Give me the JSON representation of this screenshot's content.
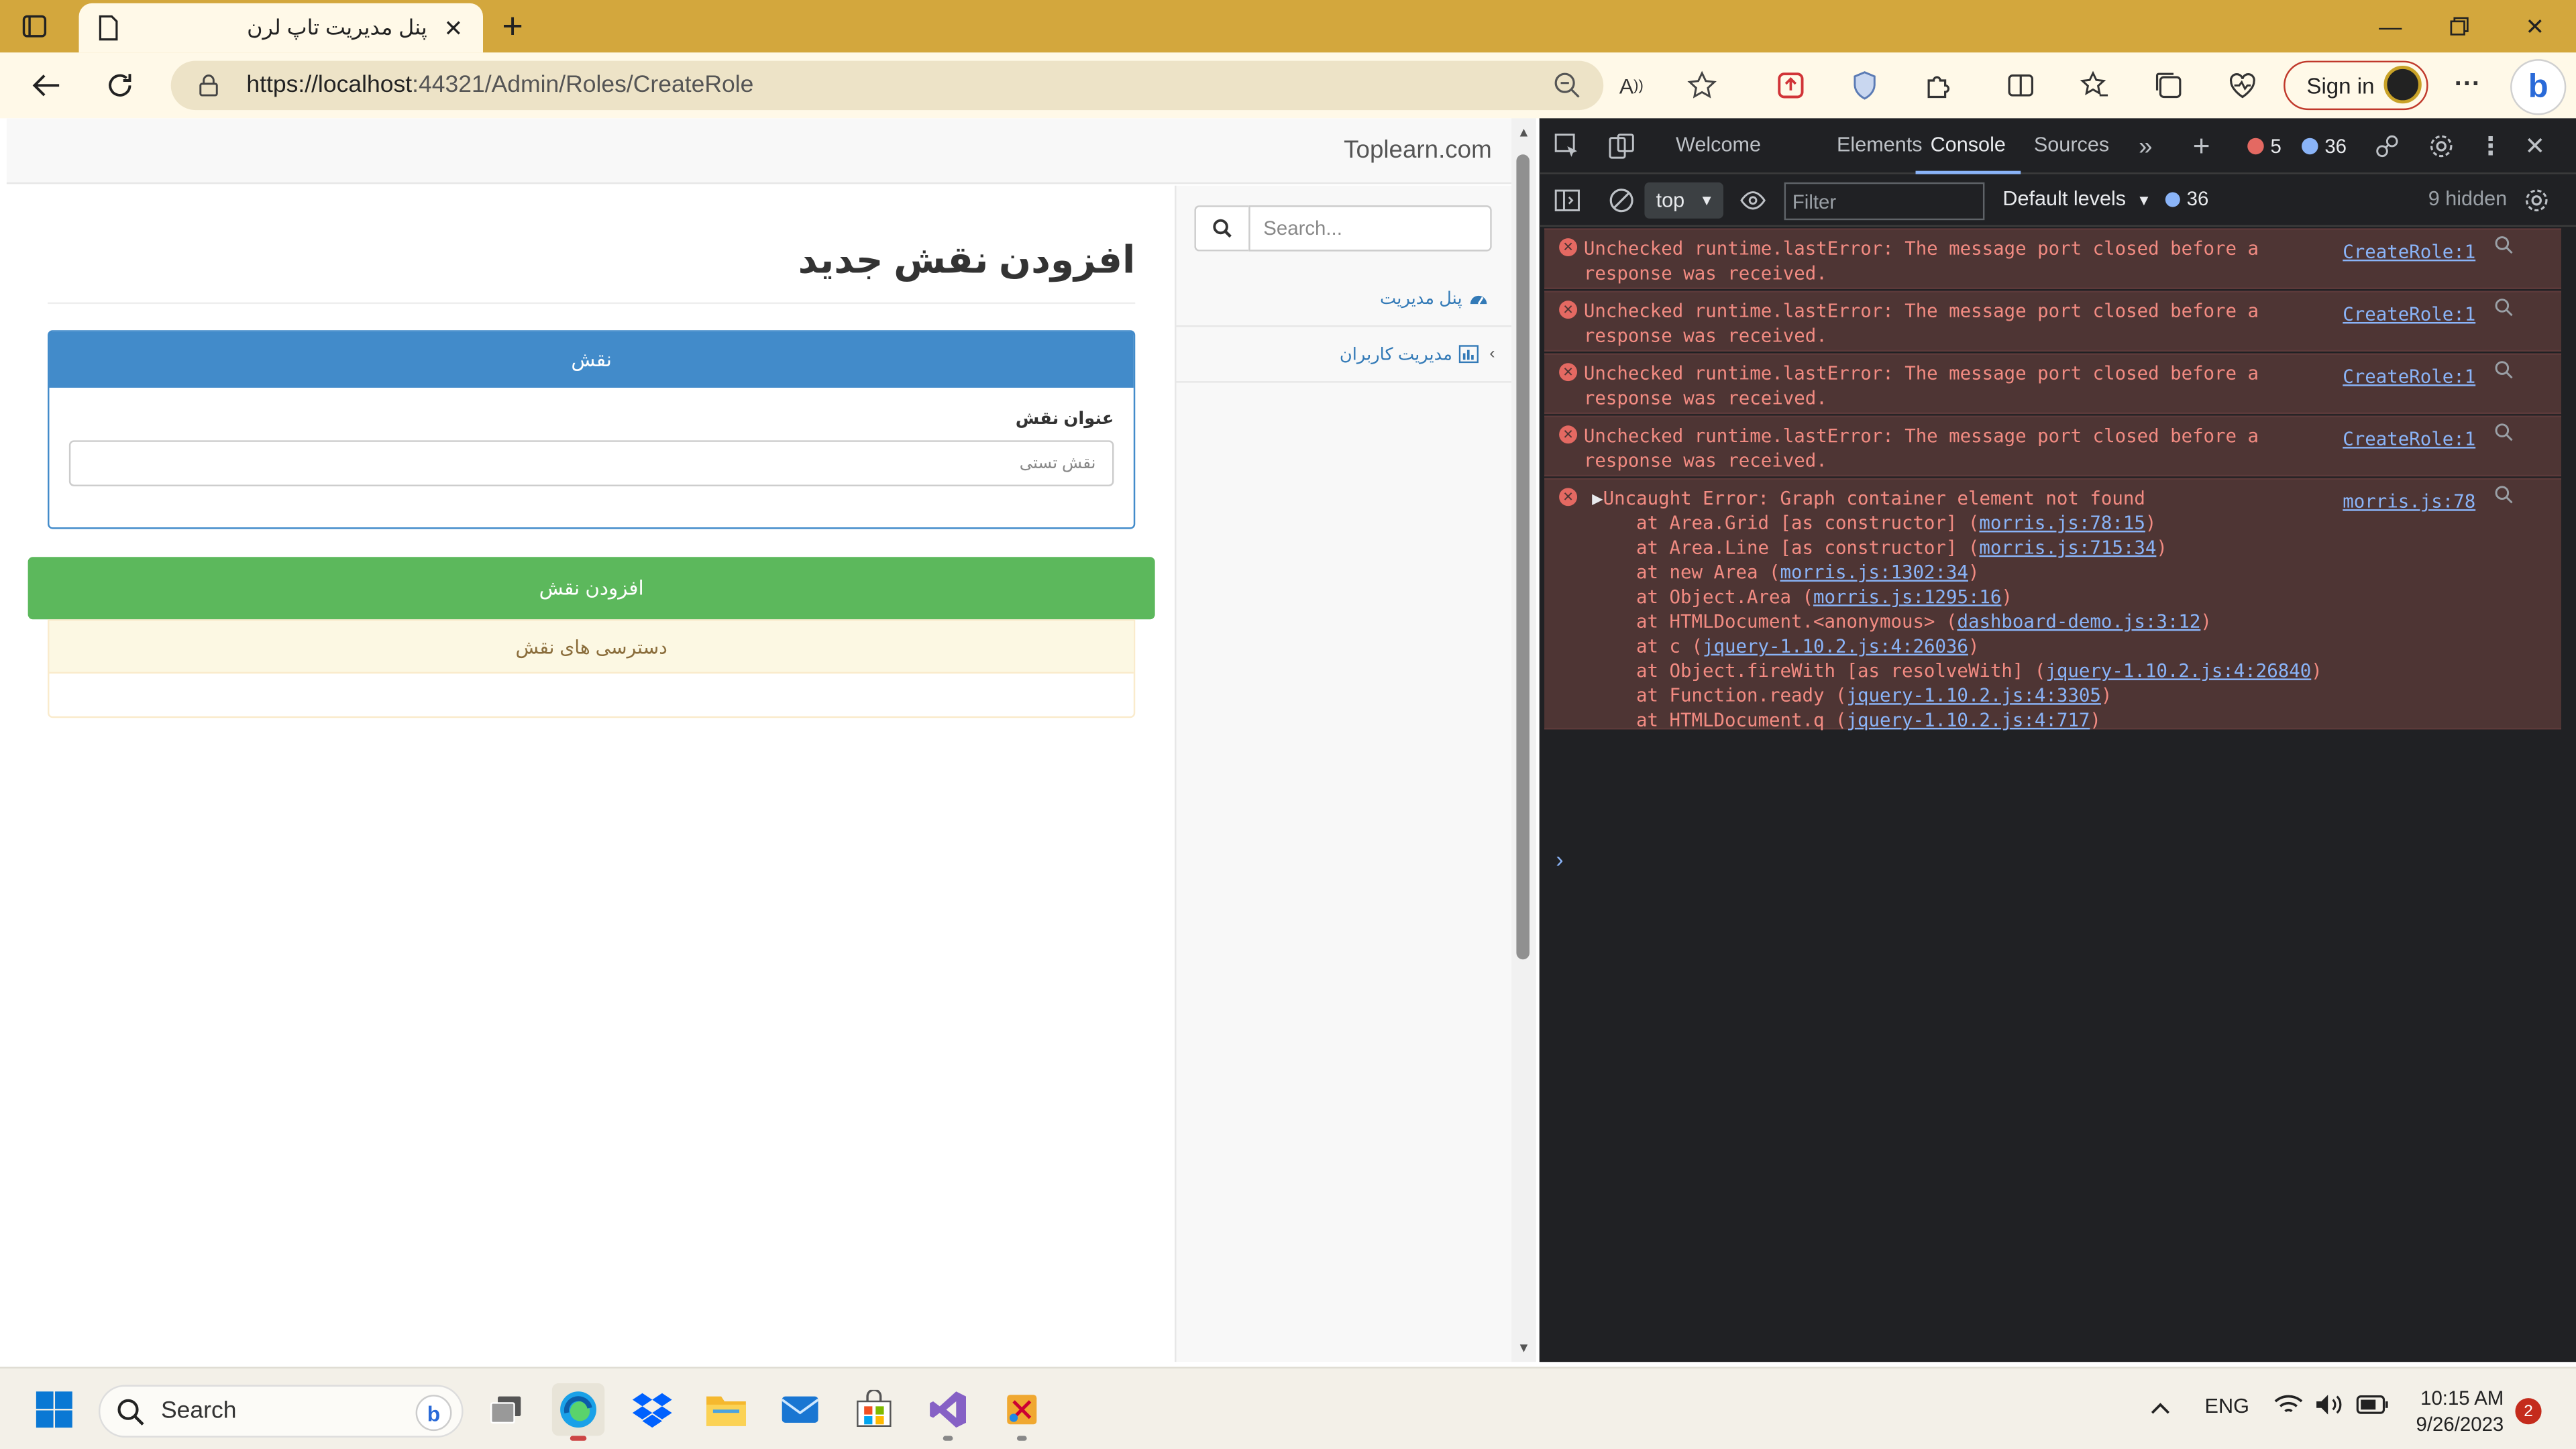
{
  "browser": {
    "tab_title": "پنل مدیریت تاپ لرن",
    "url_host": "https://localhost",
    "url_rest": ":44321/Admin/Roles/CreateRole",
    "signin_label": "Sign in"
  },
  "site": {
    "brand": "Toplearn.com",
    "search_placeholder": "Search...",
    "sidebar": [
      {
        "label": "پنل مدیریت"
      },
      {
        "label": "مدیریت کاربران"
      }
    ],
    "page_title": "افزودن نقش جدید",
    "panel_heading": "نقش",
    "field_label": "عنوان نقش",
    "field_value": "نقش تستی",
    "submit_label": "افزودن نقش",
    "permissions_heading": "دسترسی های نقش"
  },
  "devtools": {
    "tabs": [
      "Welcome",
      "Elements",
      "Console",
      "Sources"
    ],
    "active_tab": "Console",
    "error_count": "5",
    "info_count": "36",
    "context": "top",
    "filter_placeholder": "Filter",
    "levels": "Default levels",
    "msg_count": "36",
    "hidden": "9 hidden",
    "errors": [
      {
        "line1": "Unchecked runtime.lastError: The message port closed before a",
        "line2": "response was received.",
        "source": "CreateRole:1"
      },
      {
        "line1": "Unchecked runtime.lastError: The message port closed before a",
        "line2": "response was received.",
        "source": "CreateRole:1"
      },
      {
        "line1": "Unchecked runtime.lastError: The message port closed before a",
        "line2": "response was received.",
        "source": "CreateRole:1"
      },
      {
        "line1": "Unchecked runtime.lastError: The message port closed before a",
        "line2": "response was received.",
        "source": "CreateRole:1"
      }
    ],
    "uncaught": {
      "title": "Uncaught Error: Graph container element not found",
      "source": "morris.js:78",
      "stack": [
        {
          "prefix": "    at Area.Grid [as constructor] (",
          "link": "morris.js:78:15",
          "suffix": ")"
        },
        {
          "prefix": "    at Area.Line [as constructor] (",
          "link": "morris.js:715:34",
          "suffix": ")"
        },
        {
          "prefix": "    at new Area (",
          "link": "morris.js:1302:34",
          "suffix": ")"
        },
        {
          "prefix": "    at Object.Area (",
          "link": "morris.js:1295:16",
          "suffix": ")"
        },
        {
          "prefix": "    at HTMLDocument.<anonymous> (",
          "link": "dashboard-demo.js:3:12",
          "suffix": ")"
        },
        {
          "prefix": "    at c (",
          "link": "jquery-1.10.2.js:4:26036",
          "suffix": ")"
        },
        {
          "prefix": "    at Object.fireWith [as resolveWith] (",
          "link": "jquery-1.10.2.js:4:26840",
          "suffix": ")"
        },
        {
          "prefix": "    at Function.ready (",
          "link": "jquery-1.10.2.js:4:3305",
          "suffix": ")"
        },
        {
          "prefix": "    at HTMLDocument.q (",
          "link": "jquery-1.10.2.js:4:717",
          "suffix": ")"
        }
      ]
    }
  },
  "taskbar": {
    "search_label": "Search",
    "language": "ENG",
    "time": "10:15 AM",
    "date": "9/26/2023",
    "notifications": "2"
  },
  "colors": {
    "tabstrip": "#d3a73d",
    "toolbar": "#fff9e8",
    "primary": "#428bca",
    "success": "#5cb85c",
    "devtools_bg": "#202124",
    "error_bg": "#4e3534"
  }
}
